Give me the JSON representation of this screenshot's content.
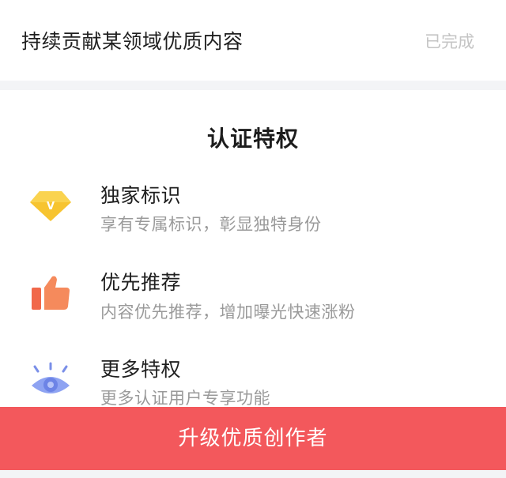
{
  "requirement": {
    "text": "持续贡献某领域优质内容",
    "status": "已完成"
  },
  "privileges": {
    "title": "认证特权",
    "items": [
      {
        "icon": "diamond-v-icon",
        "title": "独家标识",
        "desc": "享有专属标识，彰显独特身份"
      },
      {
        "icon": "thumbs-up-icon",
        "title": "优先推荐",
        "desc": "内容优先推荐，增加曝光快速涨粉"
      },
      {
        "icon": "eye-icon",
        "title": "更多特权",
        "desc": "更多认证用户专享功能"
      }
    ]
  },
  "upgrade_button": {
    "label": "升级优质创作者"
  },
  "colors": {
    "accent_button": "#f3585c",
    "status_gray": "#c4c4c4",
    "divider": "#f3f4f6"
  }
}
